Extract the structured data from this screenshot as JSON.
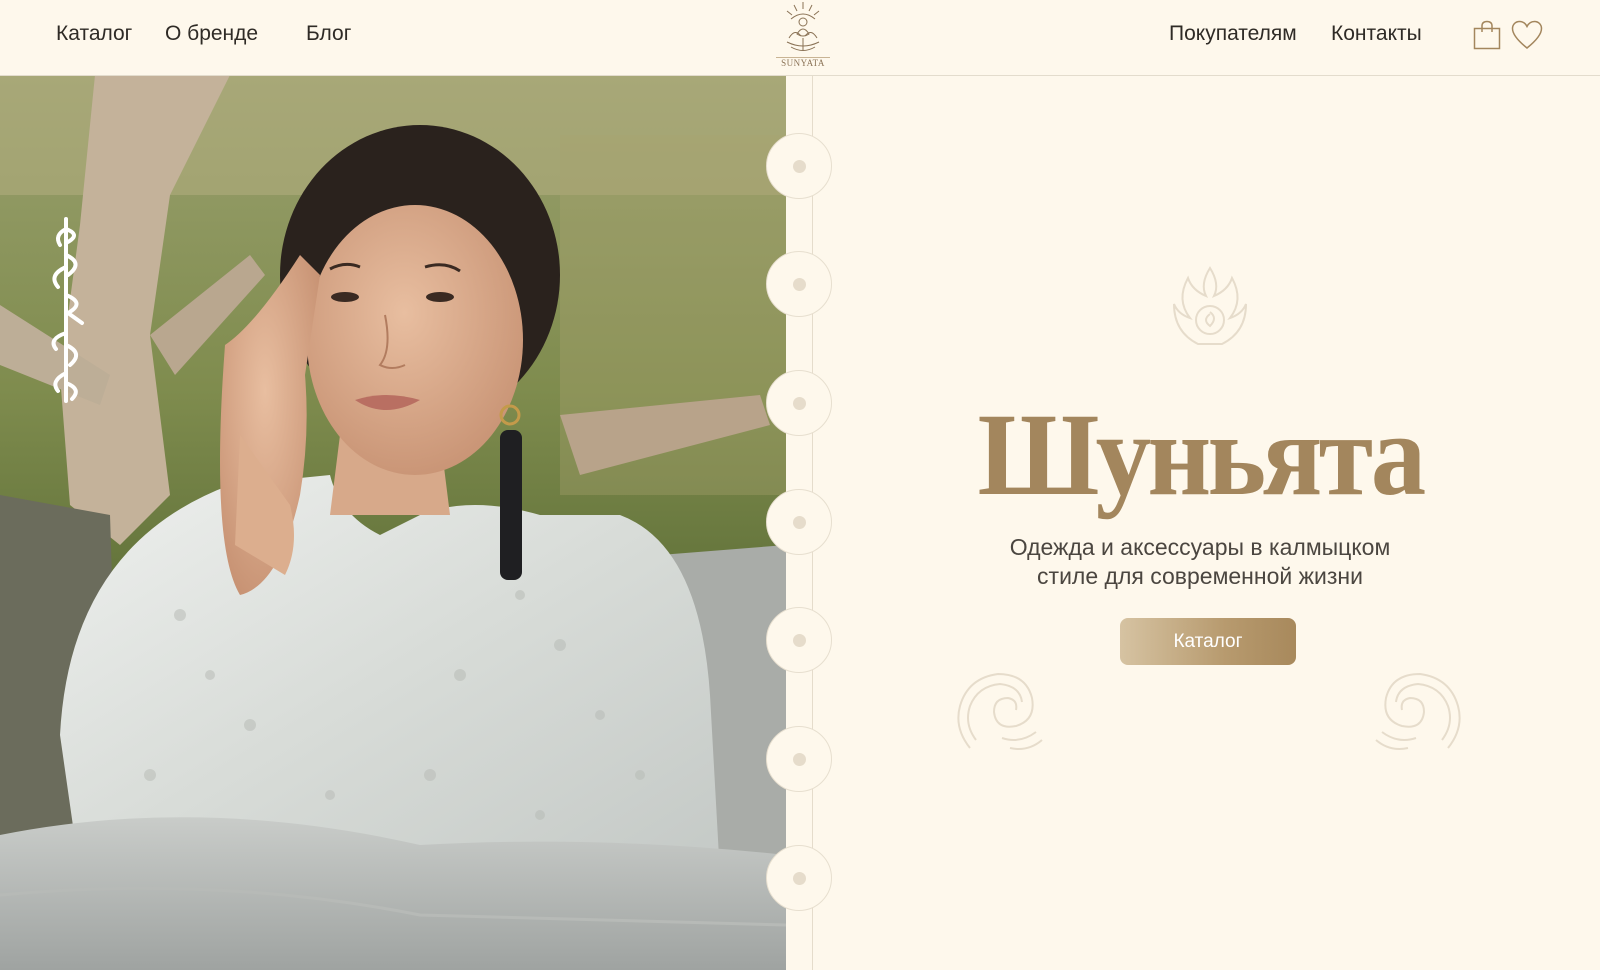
{
  "header": {
    "nav_left": [
      "Каталог",
      "О бренде",
      "Блог"
    ],
    "nav_right": [
      "Покупателям",
      "Контакты"
    ],
    "logo_text": "SUNYATA",
    "icons": [
      "shopping-bag-icon",
      "heart-icon"
    ]
  },
  "hero": {
    "title": "Шуньята",
    "subtitle_line1": "Одежда и аксессуары в калмыцком",
    "subtitle_line2": "стиле для современной жизни",
    "button_label": "Каталог"
  },
  "colors": {
    "background": "#fef8ec",
    "accent_gold": "#a3865d",
    "text_dark": "#2f2b26"
  }
}
